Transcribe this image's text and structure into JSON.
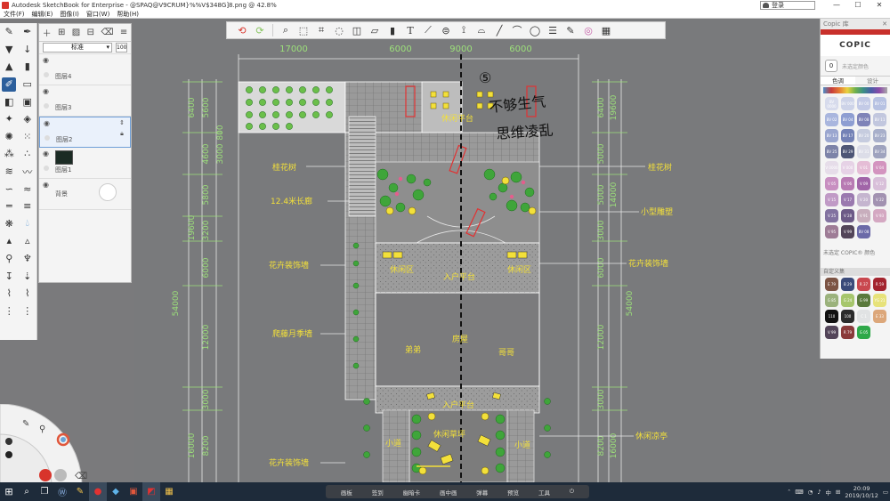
{
  "window": {
    "title": "Autodesk SketchBook for Enterprise - @SPAQ@V9CRUM}%%V$348G]8.png @ 42.8%",
    "login_label": "登录",
    "controls": [
      "—",
      "☐",
      "✕"
    ]
  },
  "menu": [
    "文件(F)",
    "编辑(E)",
    "图像(I)",
    "窗口(W)",
    "帮助(H)"
  ],
  "toolbar": {
    "icons": [
      "undo-icon",
      "redo-icon",
      "zoom-icon",
      "selection-icon",
      "crop-icon",
      "lasso-icon",
      "transform-icon",
      "distort-icon",
      "fill-icon",
      "text-icon",
      "ruler-icon",
      "ellipse-guide-icon",
      "symmetry-icon",
      "perspective-icon",
      "line-icon",
      "curve-icon",
      "shape-icon",
      "layers-icon",
      "brush-library-icon",
      "color-editor-icon",
      "copic-icon"
    ]
  },
  "layers": {
    "blend_mode": "标准",
    "opacity": "100",
    "items": [
      {
        "name": "图层4",
        "visible": true
      },
      {
        "name": "图层3",
        "visible": true
      },
      {
        "name": "图层2",
        "visible": true,
        "active": true
      },
      {
        "name": "图层1",
        "visible": true
      },
      {
        "name": "背景",
        "visible": true
      }
    ]
  },
  "copic": {
    "panel_title": "Copic 库",
    "logo": "COPIC",
    "current_label": "未选定颜色",
    "current_code": "0",
    "tabs": [
      "色调",
      "设计"
    ],
    "chips": [
      {
        "code": "BV 0000",
        "color": "#d7dbec"
      },
      {
        "code": "BV 000",
        "color": "#cdd3e8"
      },
      {
        "code": "BV 00",
        "color": "#c3cae6"
      },
      {
        "code": "BV 01",
        "color": "#b7c2e2"
      },
      {
        "code": "BV 02",
        "color": "#a9b6de"
      },
      {
        "code": "BV 04",
        "color": "#8e9ed2"
      },
      {
        "code": "BV 08",
        "color": "#7f83b8"
      },
      {
        "code": "BV 11",
        "color": "#c2c7de"
      },
      {
        "code": "BV 13",
        "color": "#9aa6cf"
      },
      {
        "code": "BV 17",
        "color": "#7482b6"
      },
      {
        "code": "BV 20",
        "color": "#c6ccdf"
      },
      {
        "code": "BV 23",
        "color": "#a8afca"
      },
      {
        "code": "BV 25",
        "color": "#7d83a8"
      },
      {
        "code": "BV 29",
        "color": "#4e5676"
      },
      {
        "code": "BV 31",
        "color": "#dcdde8"
      },
      {
        "code": "BV 34",
        "color": "#9fa3be"
      },
      {
        "code": "V 0000",
        "color": "#e6dde9"
      },
      {
        "code": "V 000",
        "color": "#e6d2e6"
      },
      {
        "code": "V 01",
        "color": "#e5bdd6"
      },
      {
        "code": "V 04",
        "color": "#d394bf"
      },
      {
        "code": "V 05",
        "color": "#c88fc1"
      },
      {
        "code": "V 06",
        "color": "#b87ab3"
      },
      {
        "code": "V 09",
        "color": "#a165a8"
      },
      {
        "code": "V 12",
        "color": "#d8bfd9"
      },
      {
        "code": "V 15",
        "color": "#c09ac6"
      },
      {
        "code": "V 17",
        "color": "#9a79af"
      },
      {
        "code": "V 20",
        "color": "#c5b5cf"
      },
      {
        "code": "V 22",
        "color": "#a292b1"
      },
      {
        "code": "V 25",
        "color": "#8272a0"
      },
      {
        "code": "V 28",
        "color": "#6d5a87"
      },
      {
        "code": "V 91",
        "color": "#c8aebd"
      },
      {
        "code": "V 93",
        "color": "#d4a8c2"
      },
      {
        "code": "V 95",
        "color": "#9e7c96"
      },
      {
        "code": "V 99",
        "color": "#534559"
      },
      {
        "code": "BV 08",
        "color": "#6b6aa8"
      }
    ],
    "no_selection_note": "未选定 COPIC® 颜色",
    "custom_title": "自定义集",
    "custom_chips": [
      {
        "code": "E 79",
        "color": "#7c5444"
      },
      {
        "code": "B 29",
        "color": "#3b4b7a"
      },
      {
        "code": "R 37",
        "color": "#c9484f"
      },
      {
        "code": "R 59",
        "color": "#a3242e"
      },
      {
        "code": "G 85",
        "color": "#9bb27c"
      },
      {
        "code": "G 24",
        "color": "#a6c66c"
      },
      {
        "code": "G 99",
        "color": "#5b7a3c"
      },
      {
        "code": "YG 21",
        "color": "#e7e27a"
      },
      {
        "code": "110",
        "color": "#111111"
      },
      {
        "code": "100",
        "color": "#2b2b2b"
      },
      {
        "code": "C 1",
        "color": "#e1e3e4"
      },
      {
        "code": "E 33",
        "color": "#dca77a"
      },
      {
        "code": "V 99",
        "color": "#534559"
      },
      {
        "code": "R 79",
        "color": "#8a3a3a"
      },
      {
        "code": "G 05",
        "color": "#2ea849"
      }
    ]
  },
  "drawing": {
    "dims_top": [
      "17000",
      "6000",
      "9000",
      "6000"
    ],
    "dims_left": [
      "6400",
      "5600",
      "4600",
      "5800",
      "3200",
      "6000",
      "12000",
      "3000",
      "8200",
      "16000",
      "19600",
      "54000"
    ],
    "dims_right": [
      "6400",
      "5000",
      "5000",
      "14000",
      "3000",
      "6000",
      "12000",
      "3000",
      "8200",
      "16000",
      "19600",
      "54000"
    ],
    "dim_3000": "3000",
    "dim_800": "800",
    "labels_left": [
      "桂花树",
      "12.4米长廊",
      "花卉装饰墙",
      "爬藤月季墙",
      "花卉装饰墙"
    ],
    "labels_right": [
      "桂花树",
      "小型雕塑",
      "花卉装饰墙",
      "休闲凉亭"
    ],
    "zones": {
      "top_platform": "休闲平台",
      "rest_left": "休闲区",
      "rest_right": "休闲区",
      "entry_top": "入户平台",
      "house": "房屋",
      "brother_left": "弟弟",
      "brother_right": "哥哥",
      "entry_bottom": "入户平台",
      "lawn": "休闲草坪",
      "path_left": "小道",
      "path_right": "小道"
    },
    "handwriting": [
      "⑤",
      "不够生气",
      "思维凌乱"
    ]
  },
  "taskbar": {
    "apps": [
      "start",
      "search",
      "task-view",
      "word-app",
      "pen-app",
      "record-app",
      "sketch-app",
      "ppt-app",
      "sketchbook-app",
      "image-app"
    ],
    "center_buttons": [
      "画板",
      "签到",
      "幽暗卡",
      "画中画",
      "弹幕",
      "预览",
      "工具"
    ],
    "tray_ime": "中",
    "time": "20:09",
    "date": "2019/10/12"
  }
}
